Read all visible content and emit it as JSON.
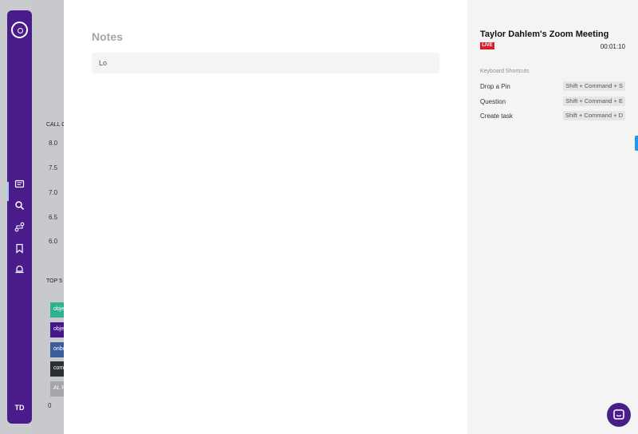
{
  "sidebar": {
    "logo_icon": "logo-icon",
    "items": [
      {
        "name": "notes-icon"
      },
      {
        "name": "search-icon"
      },
      {
        "name": "workflow-icon"
      },
      {
        "name": "bookmark-icon"
      },
      {
        "name": "bell-icon"
      }
    ],
    "avatar_initials": "TD",
    "colors": {
      "background": "#4a1b8a",
      "active_indicator": "#9ad0ff"
    }
  },
  "background_dashboard": {
    "section_call": "CALL C",
    "y_ticks": [
      "8.0",
      "7.5",
      "7.0",
      "6.5",
      "6.0"
    ],
    "section_top": "TOP 5 M",
    "tiles": [
      {
        "label": "obje",
        "color": "#2fb08f"
      },
      {
        "label": "obje",
        "color": "#44178a"
      },
      {
        "label": "onbo",
        "color": "#3c5d9a"
      },
      {
        "label": "comp",
        "color": "#2c2f33"
      },
      {
        "label": "AL P",
        "color": "#a4a6a9"
      }
    ],
    "axis_zero": "0"
  },
  "notes": {
    "title": "Notes",
    "input_value": "Lo"
  },
  "meeting": {
    "title": "Taylor Dahlem's Zoom Meeting",
    "live_badge": "LIVE",
    "timer": "00:01:10",
    "shortcuts_heading": "Keyboard Shortcuts",
    "shortcuts": [
      {
        "label": "Drop a Pin",
        "keys": "Shift + Command + S"
      },
      {
        "label": "Question",
        "keys": "Shift + Command + E"
      },
      {
        "label": "Create task",
        "keys": "Shift + Command + D"
      }
    ],
    "colors": {
      "live": "#d81b2c",
      "edge_tab": "#1e9be8"
    }
  },
  "chat_button": {
    "icon": "chat-icon",
    "color": "#4b1d8b"
  }
}
